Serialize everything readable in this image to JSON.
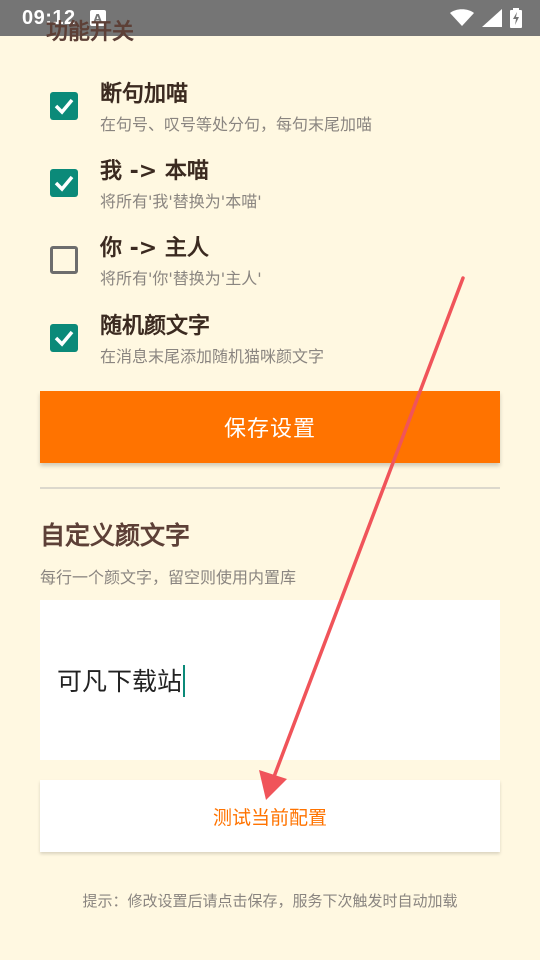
{
  "status_bar": {
    "time": "09:12",
    "notification_letter": "A"
  },
  "section": {
    "cut_title": "功能开关"
  },
  "options": [
    {
      "title": "断句加喵",
      "desc": "在句号、叹号等处分句，每句末尾加喵",
      "checked": true
    },
    {
      "title": "我 -> 本喵",
      "desc": "将所有'我'替换为'本喵'",
      "checked": true
    },
    {
      "title": "你 -> 主人",
      "desc": "将所有'你'替换为'主人'",
      "checked": false
    },
    {
      "title": "随机颜文字",
      "desc": "在消息末尾添加随机猫咪颜文字",
      "checked": true
    }
  ],
  "save_button": {
    "label": "保存设置"
  },
  "custom": {
    "title": "自定义颜文字",
    "hint": "每行一个颜文字，留空则使用内置库",
    "value": "可凡下载站"
  },
  "test_button": {
    "label": "测试当前配置"
  },
  "footer": {
    "tip": "提示：修改设置后请点击保存，服务下次触发时自动加载"
  },
  "colors": {
    "accent": "#FF7300",
    "checkbox": "#0b8a79",
    "background": "#FFF8E1",
    "status_bar": "#757575",
    "annotation_arrow": "#f0545a"
  }
}
